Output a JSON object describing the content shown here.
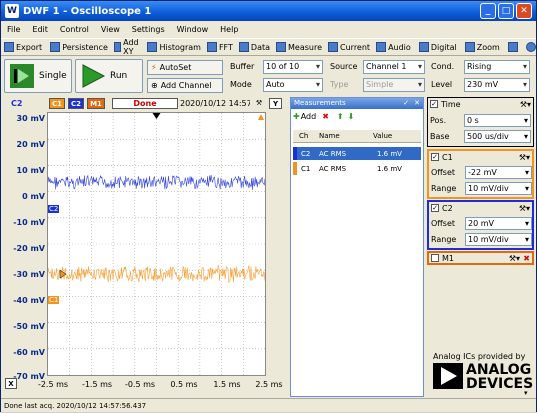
{
  "title": "DWF 1 - Oscilloscope 1",
  "app_icon": "W",
  "window_controls": {
    "minimize": "_",
    "maximize": "□",
    "close": "✕"
  },
  "menu": [
    "File",
    "Edit",
    "Control",
    "View",
    "Settings",
    "Window",
    "Help"
  ],
  "toolbar": [
    "Export",
    "Persistence",
    "Add XY",
    "Histogram",
    "FFT",
    "Data",
    "Measure",
    "Current",
    "Audio",
    "Digital",
    "Zoom"
  ],
  "controls": {
    "single": "Single",
    "run": "Run",
    "autoset": "AutoSet",
    "add_channel": "Add Channel",
    "buffer_label": "Buffer",
    "buffer_value": "10 of 10",
    "mode_label": "Mode",
    "mode_value": "Auto",
    "source_label": "Source",
    "source_value": "Channel 1",
    "type_label": "Type",
    "type_value": "Simple",
    "cond_label": "Cond.",
    "cond_value": "Rising",
    "level_label": "Level",
    "level_value": "230 mV"
  },
  "plot": {
    "axis_channel": "C2",
    "chip_c1": "C1",
    "chip_c2": "C2",
    "chip_m1": "M1",
    "state": "Done",
    "timestamp": "2020/10/12 14:57:56",
    "y_button": "Y",
    "x_button": "X",
    "y_ticks": [
      "30 mV",
      "20 mV",
      "10 mV",
      "0 mV",
      "-10 mV",
      "-20 mV",
      "-30 mV",
      "-40 mV",
      "-50 mV",
      "-60 mV",
      "-70 mV"
    ],
    "x_ticks": [
      "-2.5 ms",
      "-1.5 ms",
      "-0.5 ms",
      "0.5 ms",
      "1.5 ms",
      "2.5 ms"
    ],
    "c1_color": "#f5941d",
    "c2_color": "#1c2ed8",
    "trace_label_c1": "C1",
    "trace_label_c2": "C2"
  },
  "measurements": {
    "title": "Measurements",
    "add": "Add",
    "columns": [
      "Ch",
      "Name",
      "Value"
    ],
    "rows": [
      {
        "ch": "C2",
        "name": "AC RMS",
        "value": "1.6 mV"
      },
      {
        "ch": "C1",
        "name": "AC RMS",
        "value": "1.6 mV"
      }
    ]
  },
  "time": {
    "title": "Time",
    "pos_label": "Pos.",
    "pos_value": "0 s",
    "base_label": "Base",
    "base_value": "500 us/div"
  },
  "c1": {
    "title": "C1",
    "offset_label": "Offset",
    "offset_value": "-22 mV",
    "range_label": "Range",
    "range_value": "10 mV/div"
  },
  "c2": {
    "title": "C2",
    "offset_label": "Offset",
    "offset_value": "20 mV",
    "range_label": "Range",
    "range_value": "10 mV/div"
  },
  "m1": {
    "title": "M1"
  },
  "branding": {
    "line1": "Analog ICs provided by",
    "line2": "ANALOG",
    "line3": "DEVICES"
  },
  "status": "Done last acq. 2020/10/12 14:57:56.437"
}
